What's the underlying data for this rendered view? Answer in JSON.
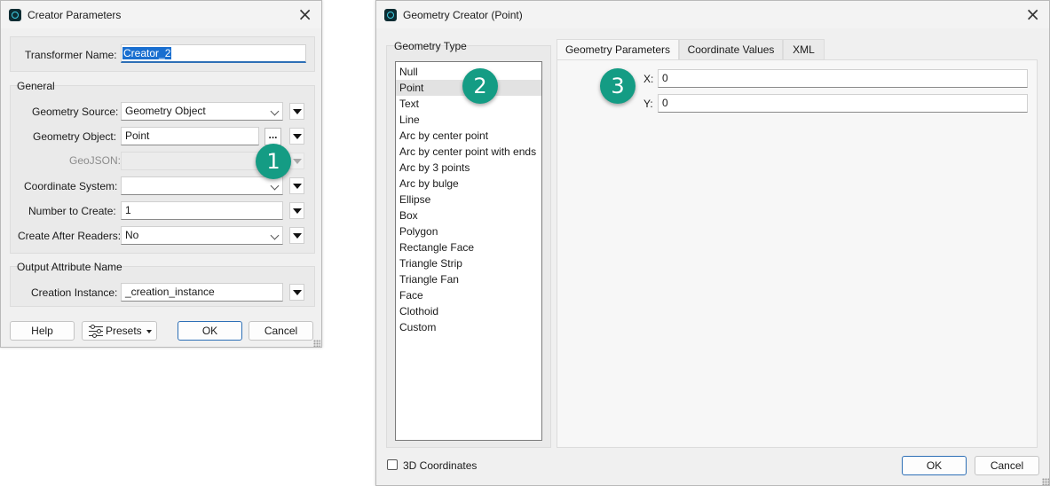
{
  "creator": {
    "title": "Creator Parameters",
    "transformer_label": "Transformer Name:",
    "transformer_value": "Creator_2",
    "general_title": "General",
    "geometry_source_label": "Geometry Source:",
    "geometry_source_value": "Geometry Object",
    "geometry_object_label": "Geometry Object:",
    "geometry_object_value": "Point",
    "dots_label": "...",
    "geojson_label": "GeoJSON:",
    "geojson_value": "",
    "coordinate_system_label": "Coordinate System:",
    "coordinate_system_value": "",
    "number_label": "Number to Create:",
    "number_value": "1",
    "after_readers_label": "Create After Readers:",
    "after_readers_value": "No",
    "output_title": "Output Attribute Name",
    "creation_instance_label": "Creation Instance:",
    "creation_instance_value": "_creation_instance",
    "help_label": "Help",
    "presets_label": "Presets",
    "ok_label": "OK",
    "cancel_label": "Cancel"
  },
  "geometry": {
    "title": "Geometry Creator (Point)",
    "type_group_title": "Geometry Type",
    "types": [
      "Null",
      "Point",
      "Text",
      "Line",
      "Arc by center point",
      "Arc by center point with ends",
      "Arc by 3 points",
      "Arc by bulge",
      "Ellipse",
      "Box",
      "Polygon",
      "Rectangle Face",
      "Triangle Strip",
      "Triangle Fan",
      "Face",
      "Clothoid",
      "Custom"
    ],
    "selected_type": "Point",
    "tabs": [
      "Geometry Parameters",
      "Coordinate Values",
      "XML"
    ],
    "active_tab": "Geometry Parameters",
    "x_label": "X:",
    "x_value": "0",
    "y_label": "Y:",
    "y_value": "0",
    "coords3d_label": "3D Coordinates",
    "coords3d_checked": false,
    "ok_label": "OK",
    "cancel_label": "Cancel"
  },
  "callouts": [
    "1",
    "2",
    "3"
  ],
  "icons": {
    "app": "fme-app-icon",
    "close": "close-icon",
    "menu": "triangle-down-icon",
    "combo": "chevron-down-icon",
    "presets": "sliders-icon"
  },
  "colors": {
    "callout": "#149c84",
    "accent": "#1a6fd0",
    "selection": "#e2e2e2"
  }
}
